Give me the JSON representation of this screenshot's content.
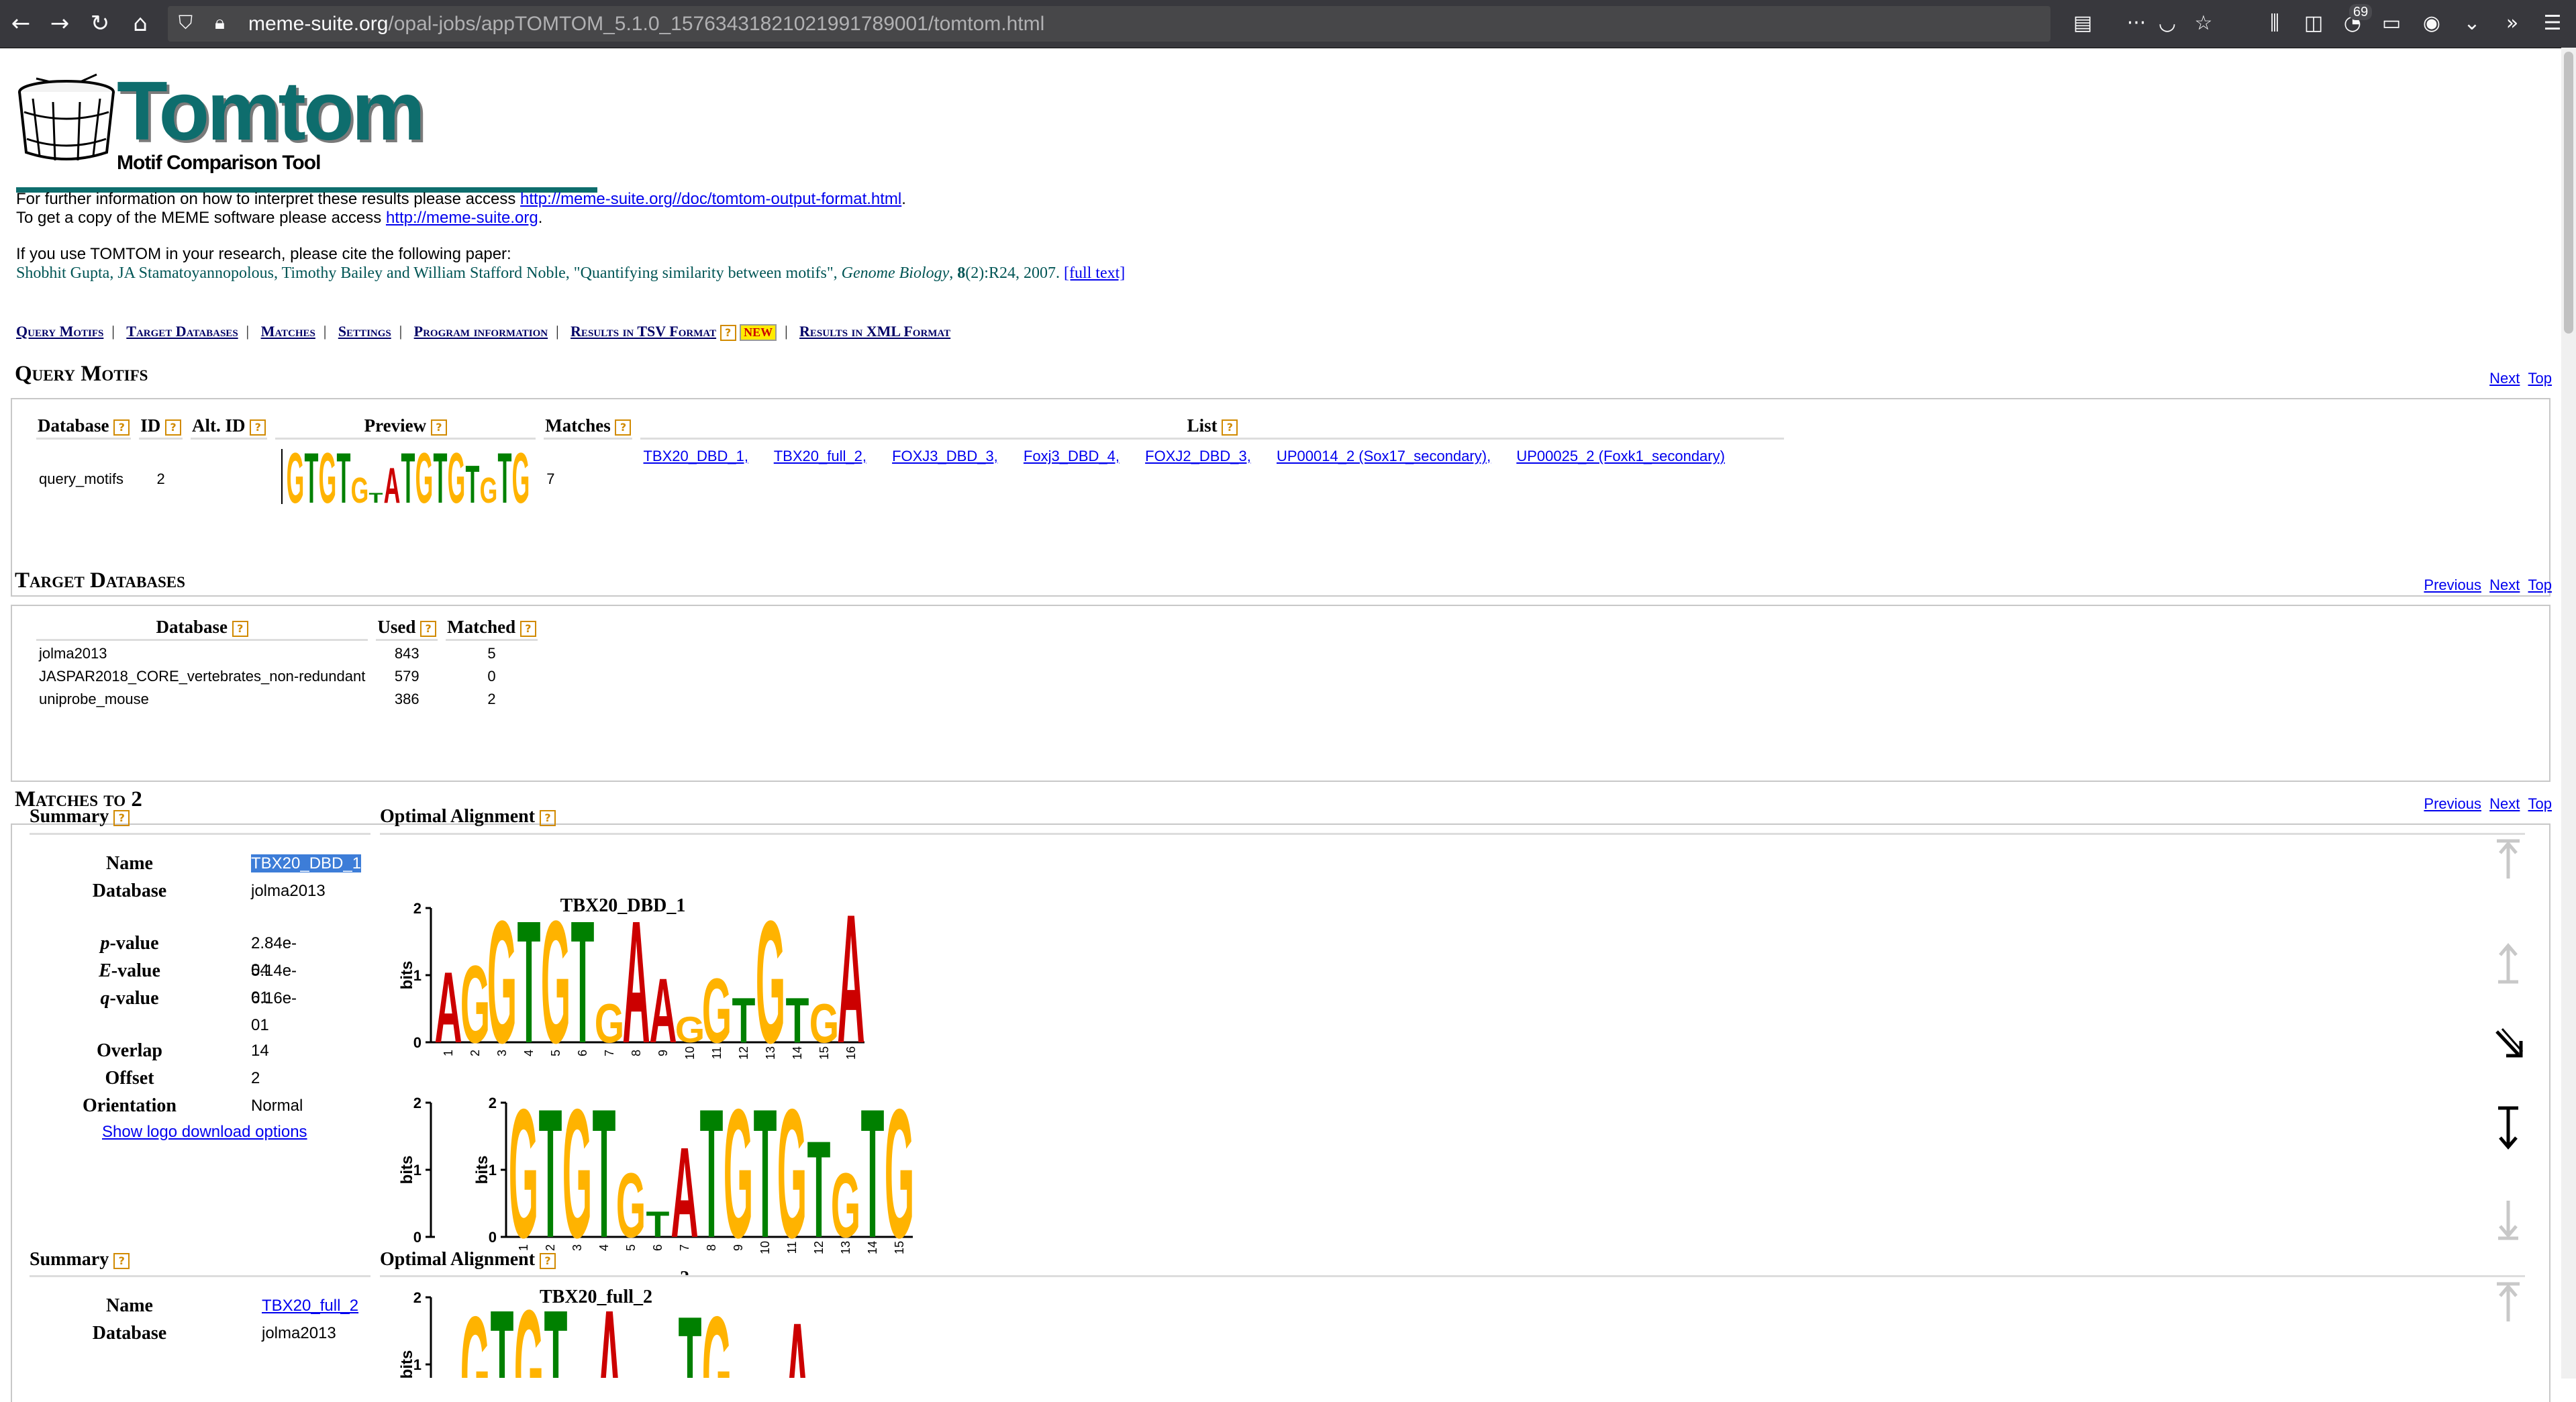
{
  "browser": {
    "url_host": "meme-suite.org",
    "url_path": "/opal-jobs/appTOMTOM_5.1.0_15763431821021991789001/tomtom.html",
    "badge_count": "69"
  },
  "logo": {
    "title": "Tomtom",
    "subtitle": "Motif Comparison Tool"
  },
  "info": {
    "line1_prefix": "For further information on how to interpret these results please access ",
    "line1_link": "http://meme-suite.org//doc/tomtom-output-format.html",
    "line1_suffix": ".",
    "line2_prefix": "To get a copy of the MEME software please access ",
    "line2_link": "http://meme-suite.org",
    "line2_suffix": "."
  },
  "citation": {
    "intro": "If you use TOMTOM in your research, please cite the following paper:",
    "authors": "Shobhit Gupta, JA Stamatoyannopolous, Timothy Bailey and William Stafford Noble, \"Quantifying similarity between motifs\",",
    "journal": "Genome Biology",
    "volume": "8",
    "rest": "(2):R24, 2007.",
    "fulltext": "[full text]"
  },
  "section_links": [
    "Query Motifs",
    "Target Databases",
    "Matches",
    "Settings",
    "Program information",
    "Results in TSV Format",
    "Results in XML Format"
  ],
  "new_badge": "NEW",
  "query_motifs": {
    "heading": "Query Motifs",
    "nav": [
      "Next",
      "Top"
    ],
    "headers": [
      "Database",
      "ID",
      "Alt. ID",
      "Preview",
      "Matches",
      "List"
    ],
    "row": {
      "database": "query_motifs",
      "id": "2",
      "alt_id": "",
      "matches": "7",
      "list": [
        "TBX20_DBD_1,",
        "TBX20_full_2,",
        "FOXJ3_DBD_3,",
        "Foxj3_DBD_4,",
        "FOXJ2_DBD_3,",
        "UP00014_2 (Sox17_secondary),",
        "UP00025_2 (Foxk1_secondary)"
      ]
    }
  },
  "target_databases": {
    "heading": "Target Databases",
    "nav": [
      "Previous",
      "Next",
      "Top"
    ],
    "headers": [
      "Database",
      "Used",
      "Matched"
    ],
    "rows": [
      [
        "jolma2013",
        "843",
        "5"
      ],
      [
        "JASPAR2018_CORE_vertebrates_non-redundant",
        "579",
        "0"
      ],
      [
        "uniprobe_mouse",
        "386",
        "2"
      ]
    ]
  },
  "matches": {
    "heading": "Matches to 2",
    "nav": [
      "Previous",
      "Next",
      "Top"
    ],
    "summary_label": "Summary",
    "alignment_label": "Optimal Alignment",
    "match1": {
      "fields": [
        [
          "Name",
          "TBX20_DBD_1"
        ],
        [
          "Database",
          "jolma2013"
        ],
        [
          "p-value",
          "2.84e-04"
        ],
        [
          "E-value",
          "5.14e-01"
        ],
        [
          "q-value",
          "6.16e-01"
        ],
        [
          "Overlap",
          "14"
        ],
        [
          "Offset",
          "2"
        ],
        [
          "Orientation",
          "Normal"
        ]
      ],
      "download_link": "Show logo download options",
      "target_logo_title": "TBX20_DBD_1",
      "target_letters": [
        "A",
        "G",
        "G",
        "T",
        "G",
        "T",
        "G",
        "A",
        "A",
        "G",
        "G",
        "T",
        "G",
        "T",
        "G",
        "A"
      ],
      "query_letters": [
        "G",
        "T",
        "G",
        "T",
        "G",
        "T",
        "A",
        "T",
        "G",
        "T",
        "G",
        "T",
        "G",
        "T",
        "G"
      ],
      "query_logo_label": "2",
      "axis_label": "bits"
    },
    "match2": {
      "fields": [
        [
          "Name",
          "TBX20_full_2"
        ],
        [
          "Database",
          "jolma2013"
        ]
      ],
      "target_logo_title": "TBX20_full_2"
    }
  }
}
